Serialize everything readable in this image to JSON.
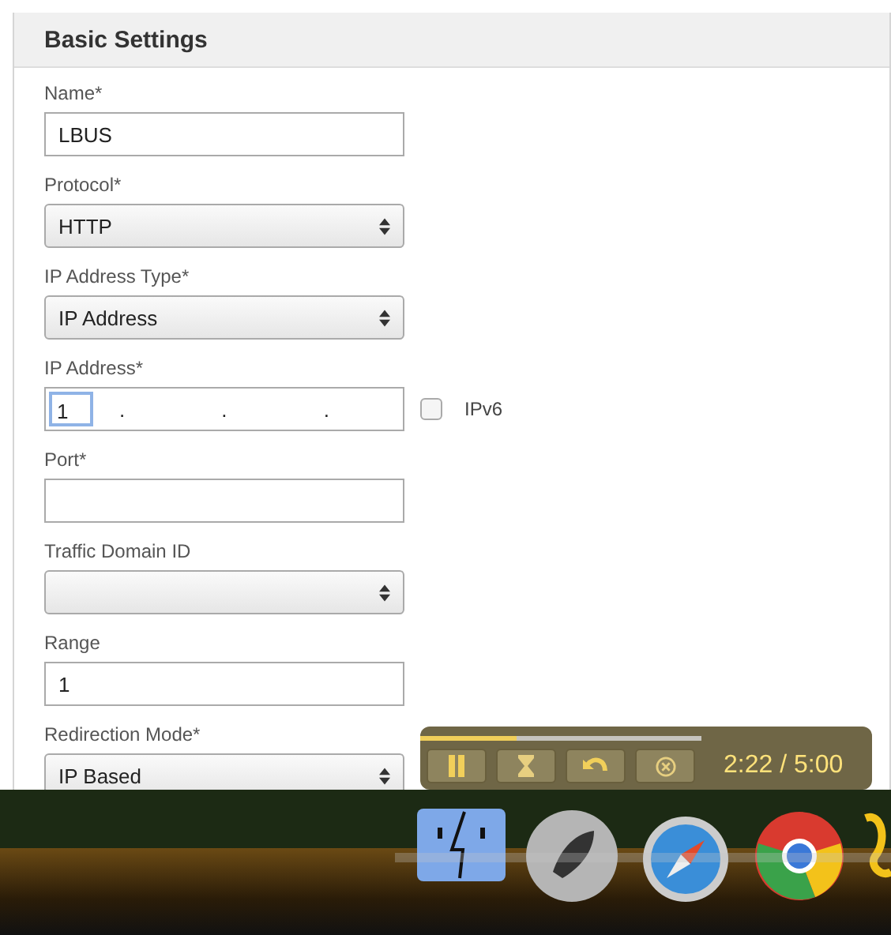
{
  "panel": {
    "title": "Basic Settings"
  },
  "fields": [
    {
      "kind": "text",
      "label": "Name*",
      "value": "LBUS"
    },
    {
      "kind": "select",
      "label": "Protocol*",
      "value": "HTTP"
    },
    {
      "kind": "select",
      "label": "IP Address Type*",
      "value": "IP Address"
    },
    {
      "kind": "ip",
      "label": "IP Address*",
      "octets": [
        "1"
      ],
      "separator": ".",
      "checkbox": {
        "label": "IPv6",
        "checked": false
      }
    },
    {
      "kind": "text",
      "label": "Port*"
    },
    {
      "kind": "select",
      "label": "Traffic Domain ID"
    },
    {
      "kind": "text",
      "label": "Range",
      "value": "1"
    },
    {
      "kind": "select",
      "label": "Redirection Mode*",
      "value": "IP Based"
    }
  ],
  "player": {
    "level": 0.34,
    "time": "2:22 / 5:00"
  }
}
